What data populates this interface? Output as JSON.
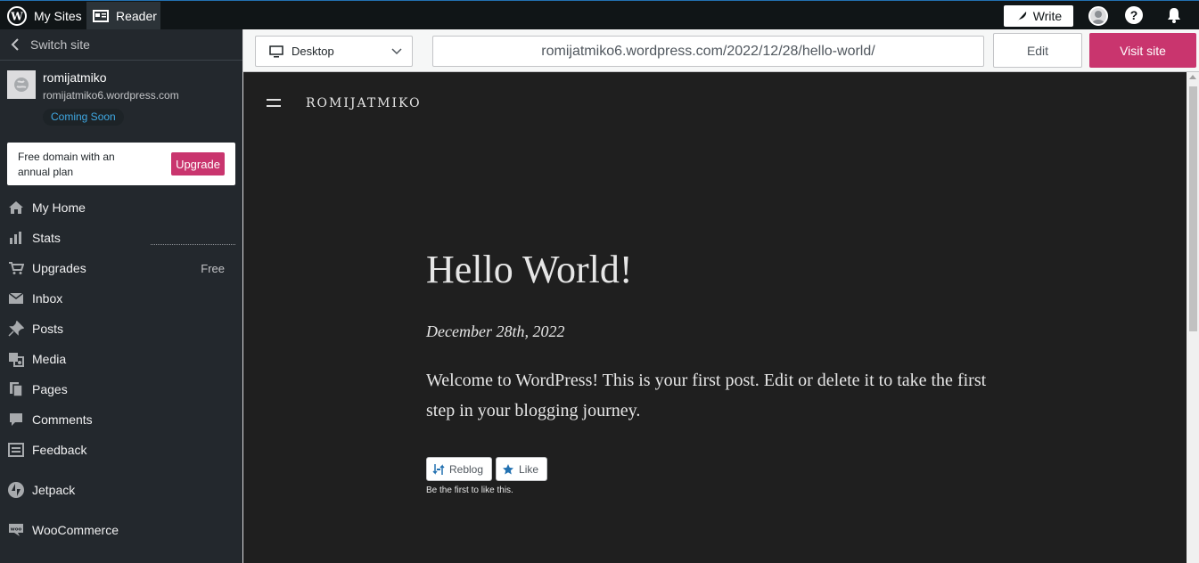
{
  "masterbar": {
    "my_sites": "My Sites",
    "reader": "Reader",
    "write": "Write"
  },
  "sidebar": {
    "switch_site": "Switch site",
    "site_name": "romijatmiko",
    "site_url": "romijatmiko6.wordpress.com",
    "status": "Coming Soon",
    "upsell_text": "Free domain with an annual plan",
    "upsell_button": "Upgrade",
    "items": [
      {
        "label": "My Home",
        "icon": "home-icon"
      },
      {
        "label": "Stats",
        "icon": "stats-icon"
      },
      {
        "label": "Upgrades",
        "icon": "cart-icon",
        "badge": "Free"
      },
      {
        "label": "Inbox",
        "icon": "mail-icon"
      },
      {
        "label": "Posts",
        "icon": "pin-icon"
      },
      {
        "label": "Media",
        "icon": "media-icon"
      },
      {
        "label": "Pages",
        "icon": "pages-icon"
      },
      {
        "label": "Comments",
        "icon": "comment-icon"
      },
      {
        "label": "Feedback",
        "icon": "feedback-icon"
      },
      {
        "label": "Jetpack",
        "icon": "jetpack-icon"
      },
      {
        "label": "WooCommerce",
        "icon": "woo-icon"
      }
    ]
  },
  "toolbar": {
    "device": "Desktop",
    "url": "romijatmiko6.wordpress.com/2022/12/28/hello-world/",
    "edit": "Edit",
    "visit": "Visit site"
  },
  "preview": {
    "site_title": "ROMIJATMIKO",
    "post_title": "Hello World!",
    "post_date": "December 28th, 2022",
    "post_body": "Welcome to WordPress! This is your first post. Edit or delete it to take the first step in your blogging journey.",
    "reblog": "Reblog",
    "like": "Like",
    "first_like": "Be the first to like this."
  },
  "colors": {
    "accent": "#c9356e",
    "masterbar": "#101517",
    "sidebar": "#23282d",
    "preview_bg": "#1f1f1f"
  }
}
